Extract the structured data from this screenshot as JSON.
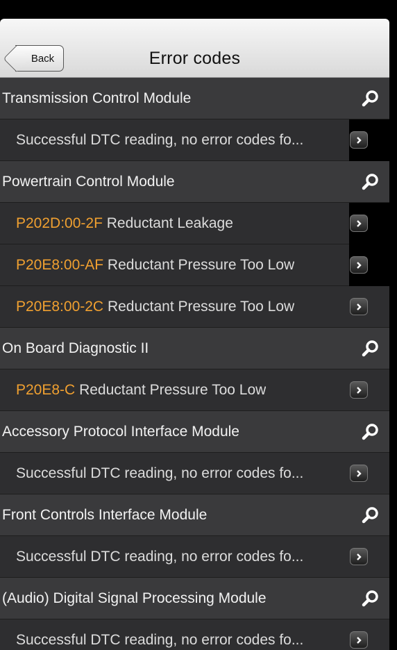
{
  "nav": {
    "back_label": "Back",
    "title": "Error codes"
  },
  "sections": [
    {
      "module": "Transmission Control Module",
      "items": [
        {
          "code": "",
          "text": "Successful DTC reading, no error codes fo..."
        }
      ]
    },
    {
      "module": "Powertrain Control Module",
      "items": [
        {
          "code": "P202D:00-2F",
          "text": "Reductant Leakage"
        },
        {
          "code": "P20E8:00-AF",
          "text": "Reductant Pressure Too Low"
        },
        {
          "code": "P20E8:00-2C",
          "text": "Reductant Pressure Too Low"
        }
      ]
    },
    {
      "module": "On Board Diagnostic II",
      "items": [
        {
          "code": "P20E8-C",
          "text": "Reductant Pressure Too Low"
        }
      ]
    },
    {
      "module": "Accessory Protocol Interface Module",
      "items": [
        {
          "code": "",
          "text": "Successful DTC reading, no error codes fo..."
        }
      ]
    },
    {
      "module": "Front Controls Interface Module",
      "items": [
        {
          "code": "",
          "text": "Successful DTC reading, no error codes fo..."
        }
      ]
    },
    {
      "module": "(Audio) Digital Signal Processing Module",
      "items": [
        {
          "code": "",
          "text": "Successful DTC reading, no error codes fo..."
        }
      ]
    }
  ],
  "icons": {
    "module_action": "search-icon",
    "item_action": "chevron-right-icon"
  },
  "colors": {
    "code_text": "#f0a030",
    "module_row_bg": "#3a3a3c",
    "item_row_bg": "#2e2e30"
  }
}
